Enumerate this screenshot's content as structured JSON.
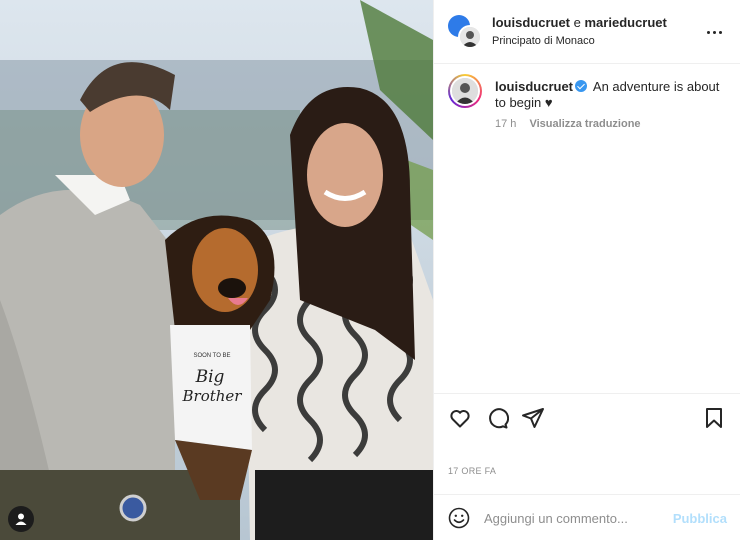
{
  "post": {
    "header": {
      "user1": "louisducruet",
      "conjunction": "e",
      "user2": "marieducruet",
      "location": "Principato di Monaco",
      "more_icon": "more-horizontal-icon"
    },
    "caption": {
      "username": "louisducruet",
      "verified_icon": "verified-badge-icon",
      "text": "An adventure is about to begin ♥",
      "time_ago": "17 h",
      "translate_label": "Visualizza traduzione"
    },
    "photo": {
      "bandana_line1": "SOON TO BE",
      "bandana_line2": "Big",
      "bandana_line3": "Brother"
    },
    "actions": {
      "like_icon": "heart-icon",
      "comment_icon": "comment-icon",
      "share_icon": "paper-plane-icon",
      "save_icon": "bookmark-icon"
    },
    "date_label": "17 ORE FA",
    "comment": {
      "emoji_icon": "smiley-icon",
      "placeholder": "Aggiungi un commento...",
      "publish_label": "Pubblica"
    },
    "colors": {
      "link_disabled": "#b2dffc",
      "verified": "#3897f0",
      "muted_text": "#8e8e8e"
    }
  }
}
